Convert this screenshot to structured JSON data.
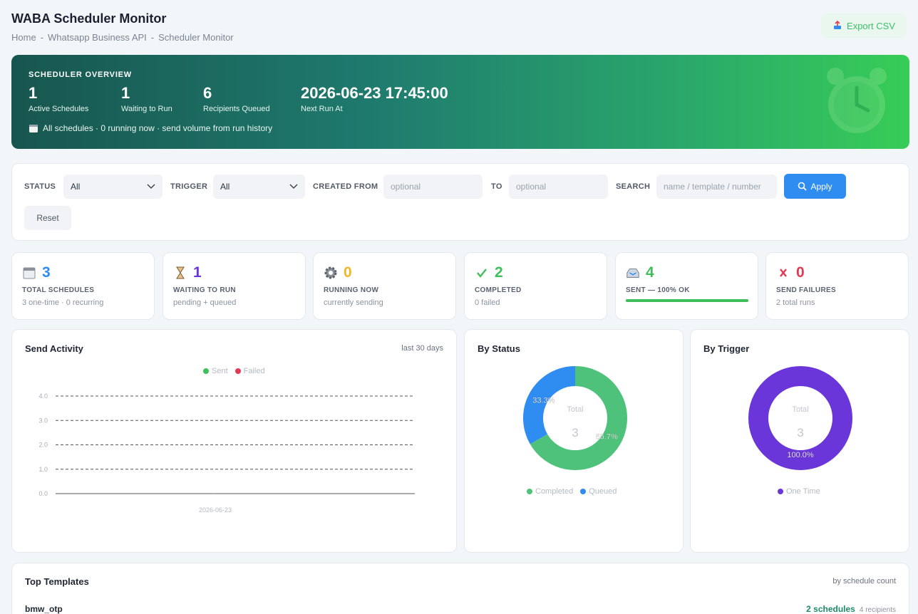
{
  "header": {
    "title": "WABA Scheduler Monitor",
    "breadcrumb": [
      "Home",
      "Whatsapp Business API",
      "Scheduler Monitor"
    ],
    "export_label": "Export CSV"
  },
  "hero": {
    "label": "SCHEDULER OVERVIEW",
    "stats": [
      {
        "value": "1",
        "label": "Active Schedules"
      },
      {
        "value": "1",
        "label": "Waiting to Run"
      },
      {
        "value": "6",
        "label": "Recipients Queued"
      },
      {
        "value": "2026-06-23 17:45:00",
        "label": "Next Run At"
      }
    ],
    "note": "All schedules · 0 running now · send volume from run history"
  },
  "filters": {
    "status_label": "STATUS",
    "status_value": "All",
    "trigger_label": "TRIGGER",
    "trigger_value": "All",
    "created_from_label": "CREATED FROM",
    "created_from_placeholder": "optional",
    "to_label": "TO",
    "to_placeholder": "optional",
    "search_label": "SEARCH",
    "search_placeholder": "name / template / number",
    "apply_label": "Apply",
    "reset_label": "Reset"
  },
  "cards": [
    {
      "icon": "calendar-icon",
      "value": "3",
      "label": "TOTAL SCHEDULES",
      "sub": "3 one-time · 0 recurring",
      "color": "#2f8cf0"
    },
    {
      "icon": "hourglass-icon",
      "value": "1",
      "label": "WAITING TO RUN",
      "sub": "pending + queued",
      "color": "#6a36d9"
    },
    {
      "icon": "gear-icon",
      "value": "0",
      "label": "RUNNING NOW",
      "sub": "currently sending",
      "color": "#f2b824"
    },
    {
      "icon": "check-icon",
      "value": "2",
      "label": "COMPLETED",
      "sub": "0 failed",
      "color": "#3fbf5a"
    },
    {
      "icon": "inbox-icon",
      "value": "4",
      "label": "SENT — 100% OK",
      "progress": 1.0,
      "color": "#3fbf5a"
    },
    {
      "icon": "cross-icon",
      "value": "0",
      "label": "SEND FAILURES",
      "sub": "2 total runs",
      "color": "#e03a55"
    }
  ],
  "activity": {
    "title": "Send Activity",
    "range": "last 30 days"
  },
  "by_status": {
    "title": "By Status",
    "center_label": "Total",
    "center_value": "3"
  },
  "by_trigger": {
    "title": "By Trigger",
    "center_label": "Total",
    "center_value": "3"
  },
  "chart_data": [
    {
      "type": "line",
      "x": [
        "2026-06-23"
      ],
      "series": [
        {
          "name": "Sent",
          "values": [
            0
          ],
          "color": "#3fbf5a"
        },
        {
          "name": "Failed",
          "values": [
            0
          ],
          "color": "#e03a55"
        }
      ],
      "yticks": [
        "4.0",
        "3.0",
        "2.0",
        "1.0",
        "0.0"
      ],
      "ylim": [
        0,
        4
      ],
      "grid": true,
      "legend": "top-center"
    },
    {
      "type": "pie",
      "categories": [
        "Completed",
        "Queued"
      ],
      "values": [
        2,
        1
      ],
      "percent_labels": [
        "66.7%",
        "33.3%"
      ],
      "colors": [
        "#4ec27a",
        "#2f8cf0"
      ],
      "legend": "bottom"
    },
    {
      "type": "pie",
      "categories": [
        "One Time"
      ],
      "values": [
        3
      ],
      "percent_labels": [
        "100.0%"
      ],
      "colors": [
        "#6a36d9"
      ],
      "legend": "bottom"
    }
  ],
  "top_templates": {
    "title": "Top Templates",
    "subtitle": "by schedule count",
    "rows": [
      {
        "name": "bmw_otp",
        "count": "2 schedules",
        "recipients": "4 recipients"
      }
    ]
  }
}
